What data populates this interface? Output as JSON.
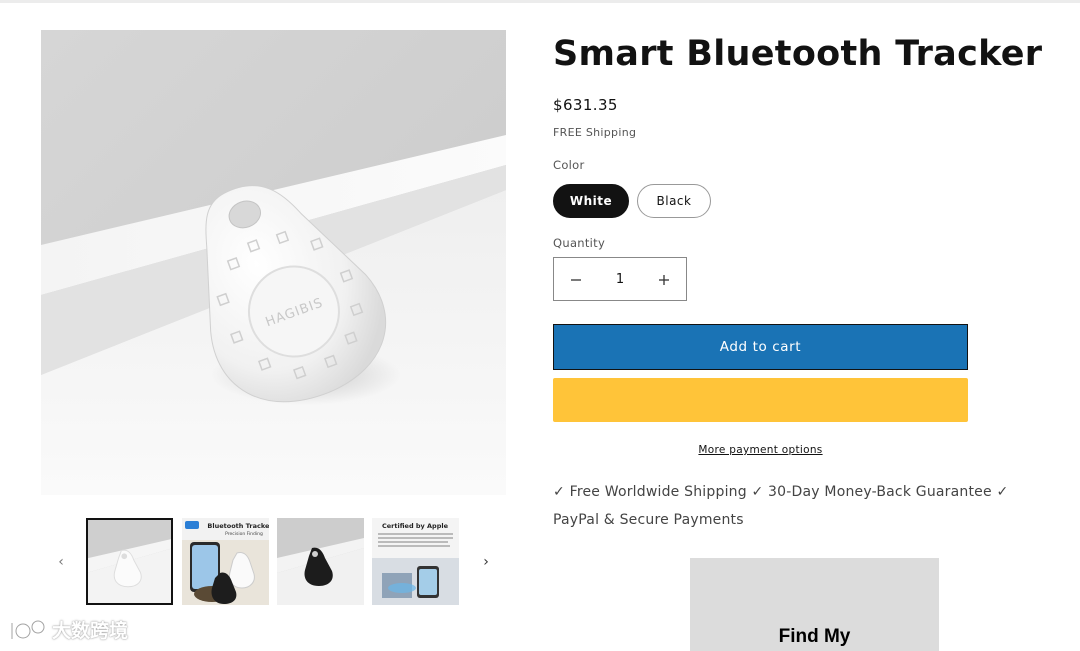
{
  "product": {
    "title": "Smart Bluetooth Tracker",
    "price": "$631.35",
    "shipping_note": "FREE Shipping",
    "color_label": "Color",
    "colors": [
      "White",
      "Black"
    ],
    "selected_color": "White",
    "quantity_label": "Quantity",
    "quantity": "1",
    "add_to_cart_label": "Add to cart",
    "more_payment_label": "More payment options",
    "guarantees_text": "✓ Free Worldwide Shipping ✓ 30-Day Money-Back Guarantee ✓ PayPal & Secure Payments",
    "promo_text": "Find My"
  },
  "gallery": {
    "prev_label": "‹",
    "next_label": "›",
    "main_engraving": "HAGIBIS",
    "thumbnails": [
      {
        "name": "white-tracker"
      },
      {
        "name": "bluetooth-tracker-promo",
        "title": "Bluetooth Tracker",
        "subtitle": "Precision Finding"
      },
      {
        "name": "black-tracker"
      },
      {
        "name": "certified-by-apple",
        "title": "Certified by Apple"
      }
    ]
  },
  "watermark": {
    "text": "大数跨境"
  },
  "colors": {
    "accent_button": "#1a73b5",
    "paypal_button": "#ffc439",
    "selected_swatch": "#121212"
  }
}
